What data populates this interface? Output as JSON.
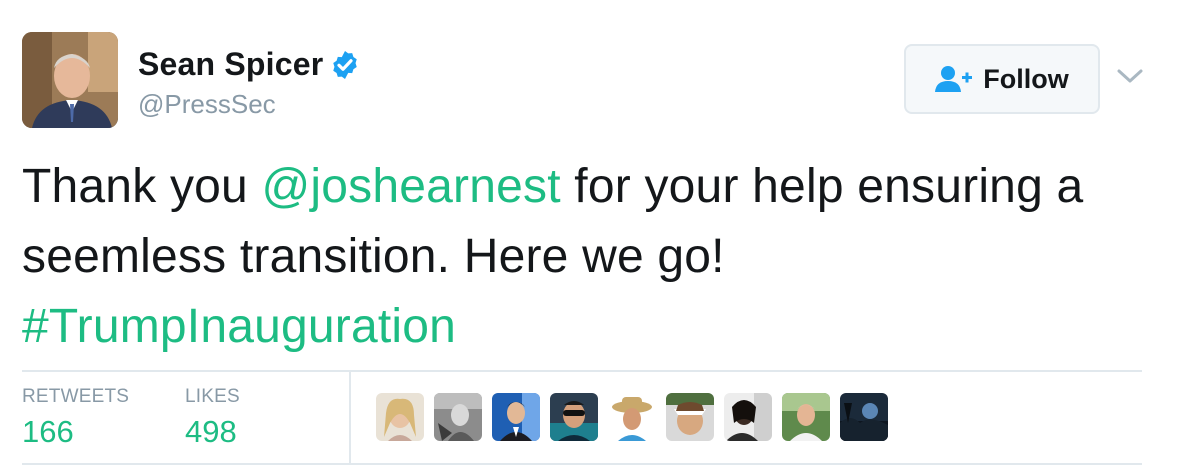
{
  "user": {
    "display_name": "Sean Spicer",
    "handle": "@PressSec",
    "verified_icon": "verified-badge-icon",
    "avatar_icon": "profile-avatar"
  },
  "follow_button": {
    "label": "Follow",
    "icon": "follow-user-plus-icon"
  },
  "menu": {
    "icon": "chevron-down-icon"
  },
  "tweet": {
    "text_part1": "Thank you ",
    "mention": "@joshearnest",
    "text_part2": " for your help ensuring a seemless transition.  Here we go!",
    "hashtag": "#TrumpInauguration"
  },
  "stats": {
    "retweets_label": "RETWEETS",
    "retweets_value": "166",
    "likes_label": "LIKES",
    "likes_value": "498"
  },
  "colors": {
    "link": "#1dbc83",
    "verified": "#1da1f2",
    "text": "#14171a",
    "muted": "#8899a6"
  }
}
